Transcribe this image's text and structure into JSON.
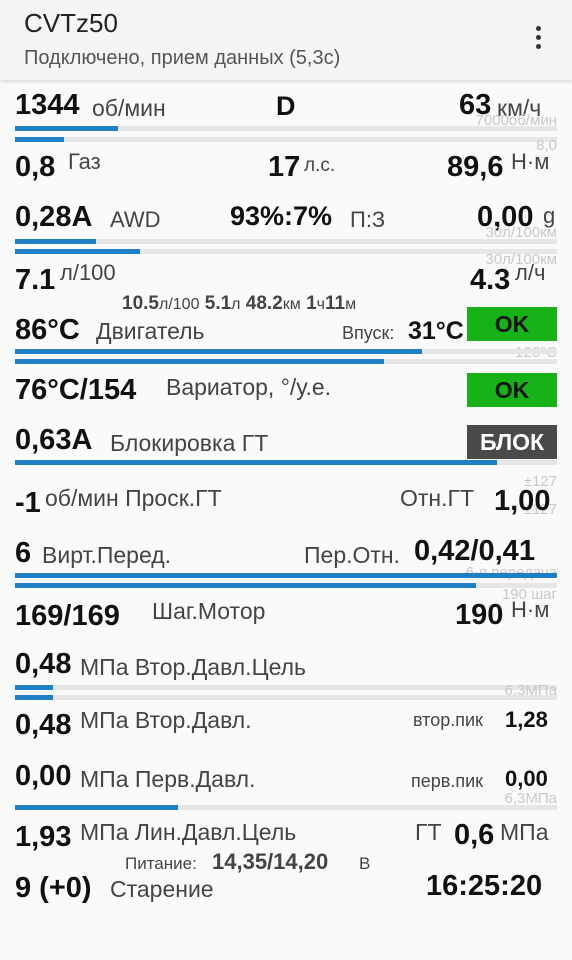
{
  "app": {
    "title": "CVTz50",
    "subtitle": "Подключено, прием данных (5,3с)",
    "menu_icon": "overflow-menu-icon"
  },
  "rpm": {
    "value": "1344",
    "unit": "об/мин",
    "gear": "D",
    "speed": "63",
    "speed_unit": "км/ч",
    "max_label": "7000об/мин",
    "rpm_fraction": 0.19,
    "speed_fraction": 0.09
  },
  "gas": {
    "scale_top": "8,0",
    "value": "0,8",
    "label": "Газ",
    "power": "17",
    "power_unit": "л.с.",
    "torque": "89,6",
    "torque_unit": "Н·м"
  },
  "awd": {
    "value": "0,28А",
    "label": "AWD",
    "split": "93%:7%",
    "split_label": "П:З",
    "fuel_inst": "0,00",
    "fuel_inst_unit": "g",
    "scale_a": "30л/100км",
    "scale_b": "30л/100км",
    "fraction_a": 0.15,
    "fraction_b": 0.23
  },
  "consumption": {
    "value": "7.1",
    "unit": "л/100",
    "hourly": "4.3",
    "hourly_unit": "л/ч"
  },
  "trip": {
    "avg": "10.5",
    "avg_unit": "л/100",
    "fuel": "5.1",
    "fuel_unit": "л",
    "dist": "48.2",
    "dist_unit": "км",
    "h": "1",
    "h_unit": "ч",
    "m": "11",
    "m_unit": "м"
  },
  "engine": {
    "temp": "86°C",
    "label": "Двигатель",
    "intake_label": "Впуск:",
    "intake": "31°C",
    "status": "OK",
    "scale": "120°C",
    "fraction_a": 0.75,
    "fraction_b": 0.68
  },
  "cvt": {
    "temp": "76°C/154",
    "label": "Вариатор, °/у.е.",
    "status": "OK"
  },
  "lockup": {
    "current": "0,63А",
    "label": "Блокировка ГТ",
    "status": "БЛОК",
    "scale": "±127",
    "fraction": 0.89
  },
  "slip": {
    "value": "-1",
    "label": "об/мин Проск.ГТ",
    "ratio_label": "Отн.ГТ",
    "ratio": "1,00",
    "scale": "±127"
  },
  "virt": {
    "gear": "6",
    "label": "Вирт.Перед.",
    "ratio_label": "Пер.Отн.",
    "ratio": "0,42/0,41",
    "scale": "6-я передача",
    "fraction_a": 1.0,
    "fraction_b": 0.85
  },
  "stepper": {
    "scale": "190 шаг",
    "value": "169/169",
    "label": "Шаг.Мотор",
    "torque": "190",
    "torque_unit": "Н·м"
  },
  "sec_target": {
    "value": "0,48",
    "label": "МПа Втор.Давл.Цель",
    "scale": "6,3МПа",
    "fraction_a": 0.07,
    "fraction_b": 0.07
  },
  "sec": {
    "value": "0,48",
    "label": "МПа Втор.Давл.",
    "peak_label": "втор.пик",
    "peak": "1,28"
  },
  "pri": {
    "value": "0,00",
    "label": "МПа Перв.Давл.",
    "peak_label": "перв.пик",
    "peak": "0,00",
    "scale": "6,3МПа",
    "fraction": 0.3
  },
  "line": {
    "value": "1,93",
    "label": "МПа Лин.Давл.Цель",
    "gt_label": "ГТ",
    "gt": "0,6",
    "gt_unit": "МПа"
  },
  "power": {
    "label": "Питание:",
    "value": "14,35/14,20",
    "unit": "В"
  },
  "aging": {
    "value": "9 (+0)",
    "label": "Старение",
    "time": "16:25:20"
  },
  "colors": {
    "bar": "#1e7fc4",
    "ok": "#17b217",
    "blok": "#4a4a4a"
  }
}
